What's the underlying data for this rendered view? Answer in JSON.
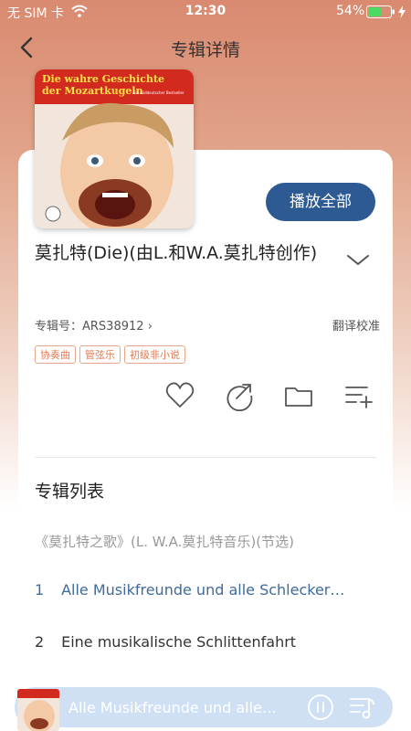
{
  "status_bar": {
    "carrier": "无 SIM 卡",
    "time": "12:30",
    "battery": "54%"
  },
  "nav": {
    "title": "专辑详情"
  },
  "album": {
    "cover_text": {
      "line1": "Die wahre Geschichte",
      "line2": "der Mozartkugeln",
      "subtitle": "Ein süddeutscher Bestseller"
    },
    "play_all_label": "播放全部",
    "title": "莫扎特(Die)(由L.和W.A.莫扎特创作)",
    "album_id": "专辑号：ARS38912",
    "translate_label": "翻译校准",
    "tags": [
      "协奏曲",
      "管弦乐",
      "初级非小说"
    ]
  },
  "tracklist": {
    "section_title": "专辑列表",
    "group_header": "《莫扎特之歌》(L. W.A.莫扎特音乐)(节选)",
    "tracks": [
      {
        "number": "1",
        "title": "Alle Musikfreunde und alle Schlecker…"
      },
      {
        "number": "2",
        "title": "Eine musikalische Schlittenfahrt"
      }
    ]
  },
  "mini_player": {
    "title": "Alle Musikfreunde und alle…"
  },
  "colors": {
    "accent": "#2e5a93",
    "tag": "#e07b57",
    "active_track": "#3f6a9c"
  },
  "icons": [
    "wifi-icon",
    "battery-icon",
    "charging-icon",
    "back-icon",
    "chevron-down-icon",
    "heart-icon",
    "share-icon",
    "folder-icon",
    "add-to-playlist-icon",
    "pause-icon",
    "playlist-icon"
  ]
}
